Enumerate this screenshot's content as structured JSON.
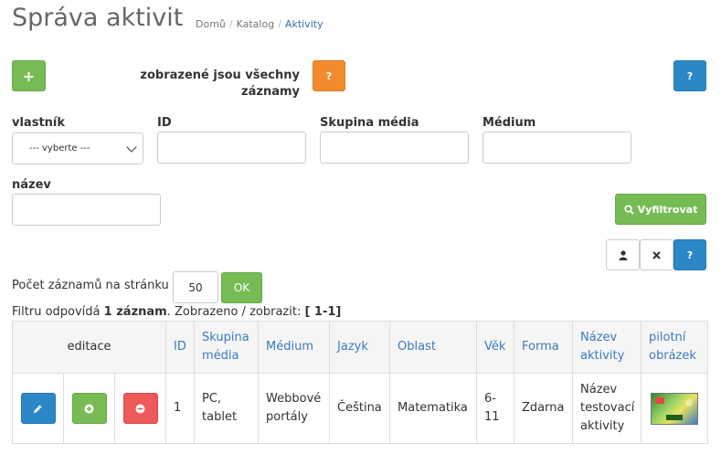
{
  "page": {
    "title": "Správa aktivit",
    "breadcrumb": [
      "Domů",
      "Katalog",
      "Aktivity"
    ]
  },
  "toolbar": {
    "add_label": "+",
    "info_text": "zobrazené jsou všechny záznamy",
    "help_label": "?",
    "help2_label": "?"
  },
  "filters": {
    "owner_label": "vlastník",
    "owner_value": "--- vyberte ---",
    "id_label": "ID",
    "media_group_label": "Skupina média",
    "media_label": "Médium",
    "name_label": "název",
    "filter_button": "Vyfiltrovat"
  },
  "list_tools": {
    "help_label": "?"
  },
  "paging": {
    "per_page_label": "Počet záznamů na stránku",
    "per_page_value": "50",
    "ok_label": "OK",
    "summary_prefix": "Filtru odpovídá",
    "summary_count": "1 záznam",
    "summary_mid": ". Zobrazeno / zobrazit:",
    "summary_range": "[ 1-1]"
  },
  "table": {
    "headers": {
      "edit": "editace",
      "id": "ID",
      "media_group": "Skupina média",
      "media": "Médium",
      "language": "Jazyk",
      "area": "Oblast",
      "age": "Věk",
      "form": "Forma",
      "name": "Název aktivity",
      "image": "pilotní obrázek"
    },
    "rows": [
      {
        "id": "1",
        "media_group": "PC, tablet",
        "media": "Webbové portály",
        "language": "Čeština",
        "area": "Matematika",
        "age": "6-11",
        "form": "Zdarna",
        "name": "Název testovací aktivity"
      }
    ]
  },
  "colors": {
    "green": "#77bb55",
    "orange": "#f28a2e",
    "blue": "#2c87c7",
    "red": "#ee5a5a",
    "link": "#3a7ac0"
  }
}
